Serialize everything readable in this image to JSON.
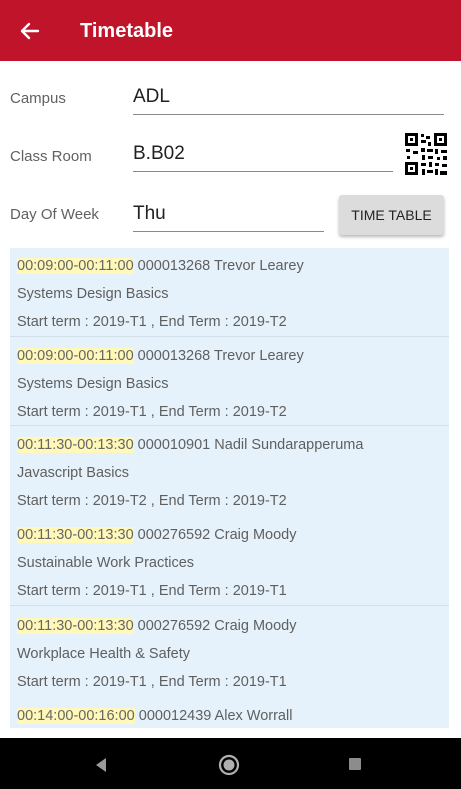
{
  "appbar": {
    "title": "Timetable"
  },
  "form": {
    "campus": {
      "label": "Campus",
      "value": "ADL"
    },
    "room": {
      "label": "Class Room",
      "value": "B.B02"
    },
    "day": {
      "label": "Day Of Week",
      "value": "Thu"
    },
    "button_label": "TIME TABLE"
  },
  "entries": [
    {
      "time": "00:09:00-00:11:00",
      "info": "000013268  Trevor Learey",
      "course": "Systems Design Basics",
      "terms": "Start term :  2019-T1  , End Term :  2019-T2"
    },
    {
      "time": "00:09:00-00:11:00",
      "info": "000013268  Trevor Learey",
      "course": "Systems Design Basics",
      "terms": "Start term :  2019-T1  , End Term :  2019-T2"
    },
    {
      "time": "00:11:30-00:13:30",
      "info": "000010901  Nadil Sundarapperuma",
      "course": "Javascript Basics",
      "terms": "Start term :  2019-T2  , End Term :  2019-T2"
    },
    {
      "time": "00:11:30-00:13:30",
      "info": "000276592  Craig Moody",
      "course": "Sustainable Work Practices",
      "terms": "Start term :  2019-T1  , End Term :  2019-T1"
    },
    {
      "time": "00:11:30-00:13:30",
      "info": "000276592  Craig Moody",
      "course": "Workplace Health & Safety",
      "terms": "Start term :  2019-T1  , End Term :  2019-T1"
    },
    {
      "time": "00:14:00-00:16:00",
      "info": "000012439  Alex Worrall",
      "course": "",
      "terms": ""
    }
  ],
  "icons": {
    "back": "arrow-back-icon",
    "qr": "qr-code-icon",
    "nav_back": "triangle-back-icon",
    "nav_home": "circle-home-icon",
    "nav_recent": "square-recent-icon"
  },
  "colors": {
    "appbar": "#c0142a",
    "list_background": "#e6f2fb",
    "time_highlight": "#fff8b8",
    "button": "#dcdcdc"
  }
}
